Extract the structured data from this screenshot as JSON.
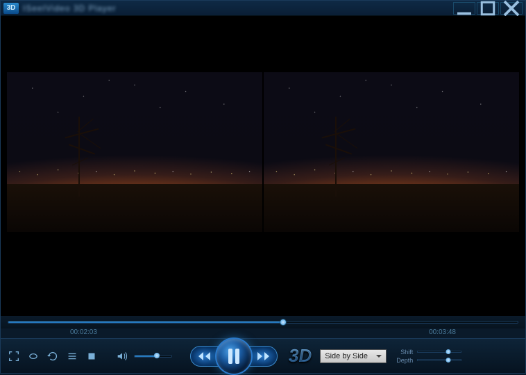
{
  "titlebar": {
    "badge": "3D",
    "title": "ISeeIVideo 3D Player"
  },
  "playback": {
    "current_time": "00:02:03",
    "total_time": "00:03:48",
    "progress_percent": 53.9,
    "volume_percent": 60
  },
  "controls": {
    "button_3d_label": "3D",
    "mode_selected": "Side by Side",
    "shift_label": "Shift",
    "depth_label": "Depth",
    "shift_percent": 70,
    "depth_percent": 70
  }
}
